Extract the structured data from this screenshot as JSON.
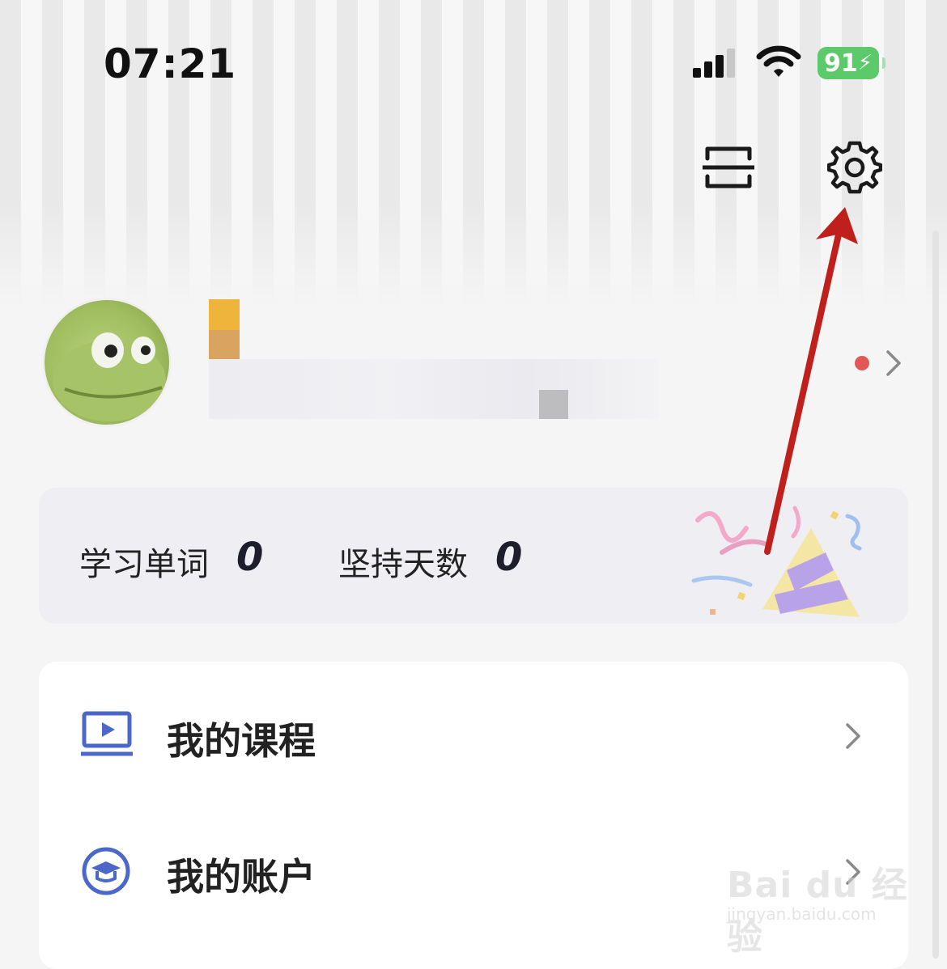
{
  "status_bar": {
    "time": "07:21",
    "battery": "91"
  },
  "header": {
    "scan_icon": "scan-icon",
    "settings_icon": "gear-icon"
  },
  "profile": {
    "avatar": "frog-avatar",
    "has_notification_dot": true
  },
  "stats": {
    "words_label": "学习单词",
    "words_value": "0",
    "days_label": "坚持天数",
    "days_value": "0"
  },
  "menu": {
    "items": [
      {
        "label": "我的课程",
        "icon": "video-course-icon"
      },
      {
        "label": "我的账户",
        "icon": "graduation-cap-icon"
      }
    ]
  },
  "watermark": {
    "brand": "Bai du 经验",
    "sub": "jingyan.baidu.com"
  },
  "colors": {
    "accent_blue": "#4a67c9",
    "arrow_red": "#c0201c",
    "battery_green": "#5cc96a"
  }
}
